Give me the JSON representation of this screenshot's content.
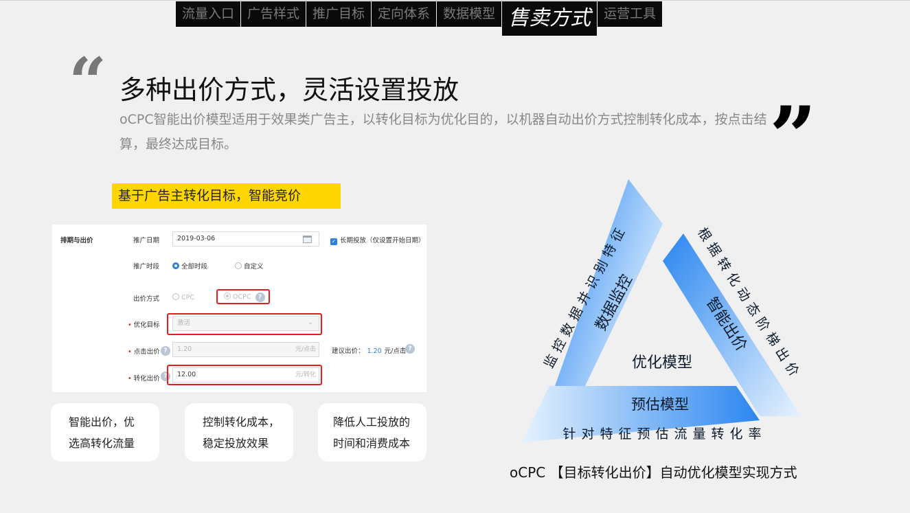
{
  "nav": {
    "tabs": [
      {
        "label": "流量入口"
      },
      {
        "label": "广告样式"
      },
      {
        "label": "推广目标"
      },
      {
        "label": "定向体系"
      },
      {
        "label": "数据模型"
      },
      {
        "label": "售卖方式",
        "active": true
      },
      {
        "label": "运营工具"
      }
    ]
  },
  "heading": {
    "quote_open": "“",
    "quote_close": "”",
    "title": "多种出价方式，灵活设置投放",
    "subtitle": "oCPC智能出价模型适用于效果类广告主，以转化目标为优化目的，以机器自动出价方式控制转化成本，按点击结算，最终达成目标。"
  },
  "tag": "基于广告主转化目标，智能竞价",
  "form": {
    "section_label": "排期与出价",
    "date": {
      "label": "推广日期",
      "value": "2019-03-06",
      "checkbox_label": "长期投放（仅设置开始日期）"
    },
    "period": {
      "label": "推广时段",
      "option_all": "全部时段",
      "option_custom": "自定义"
    },
    "bid_method": {
      "label": "出价方式",
      "option_cpc": "CPC",
      "option_ocpc": "OCPC",
      "help": "?"
    },
    "goal": {
      "label": "优化目标",
      "value": "激活"
    },
    "click_bid": {
      "label": "点击出价",
      "value": "1.20",
      "unit": "元/点击",
      "suggest_label": "建议出价：",
      "suggest_value": "1.20",
      "suggest_unit": "元/点击"
    },
    "conv_bid": {
      "label": "转化出价",
      "value": "12.00",
      "unit": "元/转化"
    }
  },
  "cards": [
    {
      "line1": "智能出价，优",
      "line2": "选高转化流量"
    },
    {
      "line1": "控制转化成本，",
      "line2": "稳定投放效果"
    },
    {
      "line1": "降低人工投放的",
      "line2": "时间和消费成本"
    }
  ],
  "diagram": {
    "left_band": "数据监控",
    "right_band": "智能出价",
    "bottom_band": "预估模型",
    "center": "优化模型",
    "left_side_text": "监控数据并识别特征",
    "right_side_text": "根据转化动态阶梯出价",
    "bottom_text": "针对特征预估流量转化率",
    "caption": "oCPC 【目标转化出价】自动优化模型实现方式",
    "colors": {
      "blue": "#2a86f0",
      "light": "#e6f2fe"
    }
  }
}
